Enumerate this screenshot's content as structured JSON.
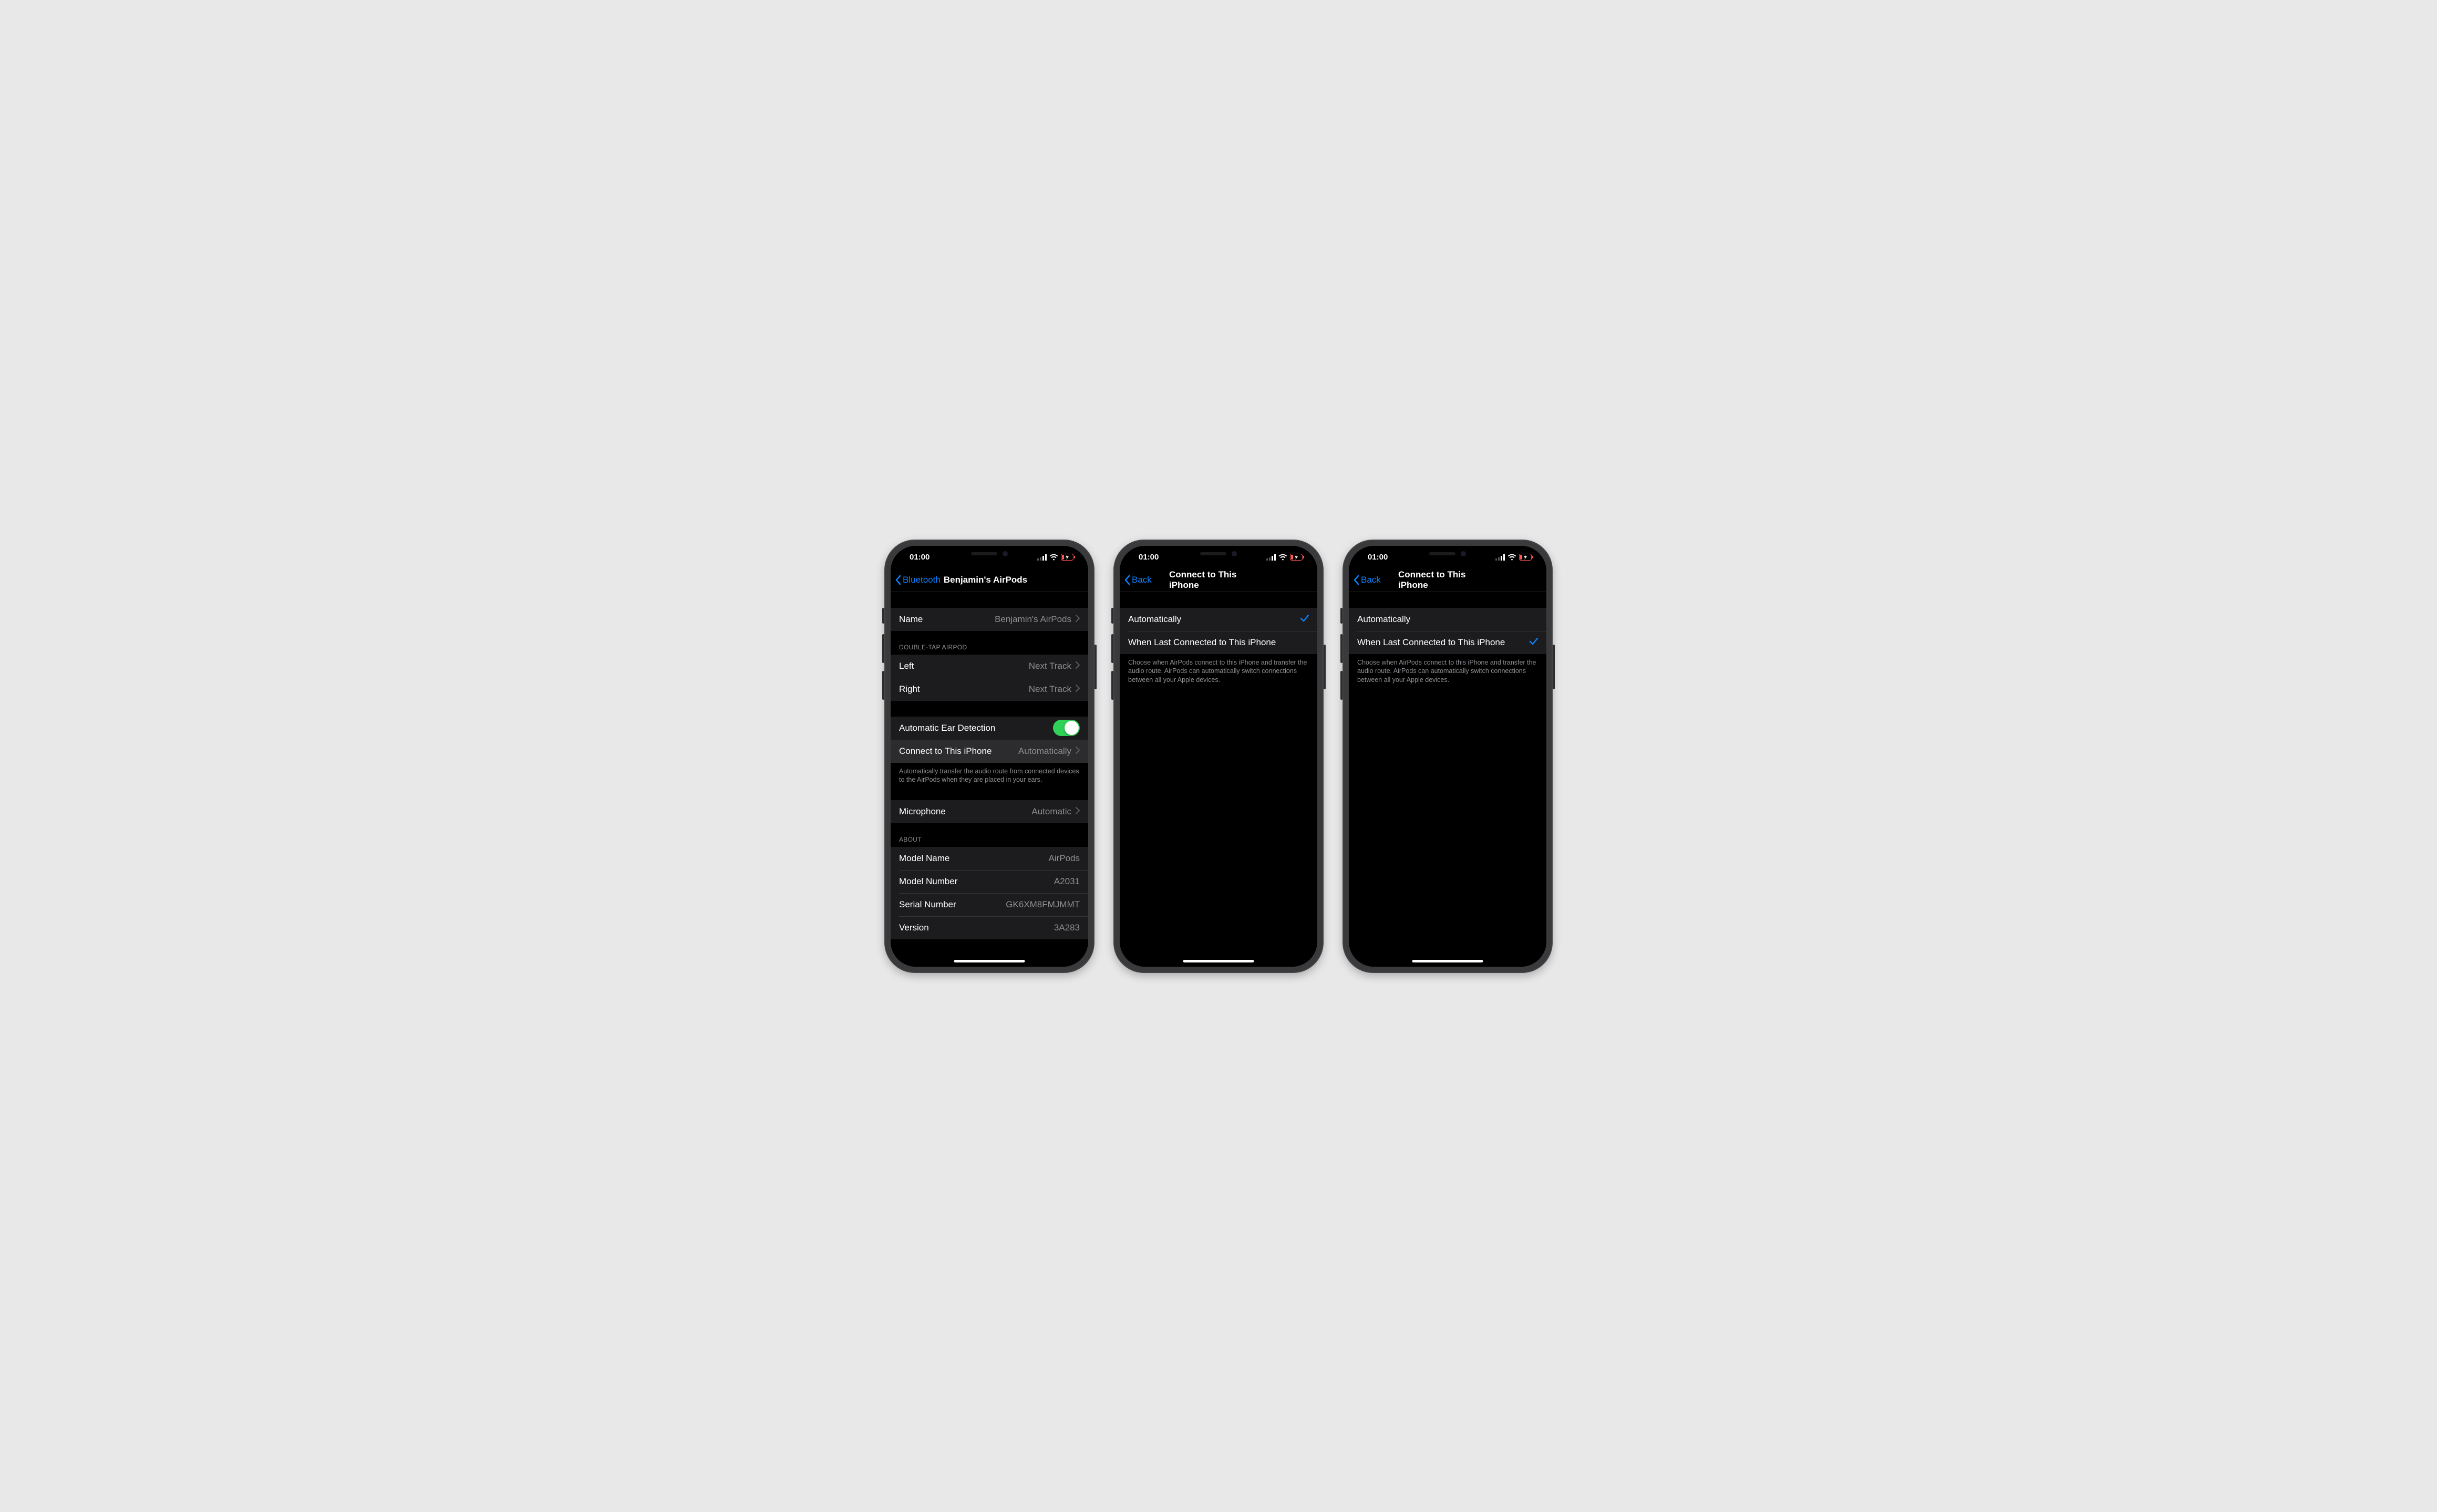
{
  "status": {
    "time": "01:00"
  },
  "phone1": {
    "nav_back": "Bluetooth",
    "nav_title": "Benjamin's AirPods",
    "name_label": "Name",
    "name_value": "Benjamin's AirPods",
    "section_doubletap": "DOUBLE-TAP AIRPOD",
    "left_label": "Left",
    "left_value": "Next Track",
    "right_label": "Right",
    "right_value": "Next Track",
    "ear_label": "Automatic Ear Detection",
    "ear_on": true,
    "connect_label": "Connect to This iPhone",
    "connect_value": "Automatically",
    "connect_footer": "Automatically transfer the audio route from connected devices to the AirPods when they are placed in your ears.",
    "mic_label": "Microphone",
    "mic_value": "Automatic",
    "section_about": "ABOUT",
    "model_name_label": "Model Name",
    "model_name_value": "AirPods",
    "model_number_label": "Model Number",
    "model_number_value": "A2031",
    "serial_label": "Serial Number",
    "serial_value": "GK6XM8FMJMMT",
    "version_label": "Version",
    "version_value": "3A283"
  },
  "phone2": {
    "nav_back": "Back",
    "nav_title": "Connect to This iPhone",
    "opt_auto": "Automatically",
    "opt_last": "When Last Connected to This iPhone",
    "selected": "auto",
    "footer": "Choose when AirPods connect to this iPhone and transfer the audio route. AirPods can automatically switch connections between all your Apple devices."
  },
  "phone3": {
    "nav_back": "Back",
    "nav_title": "Connect to This iPhone",
    "opt_auto": "Automatically",
    "opt_last": "When Last Connected to This iPhone",
    "selected": "last",
    "footer": "Choose when AirPods connect to this iPhone and transfer the audio route. AirPods can automatically switch connections between all your Apple devices."
  }
}
